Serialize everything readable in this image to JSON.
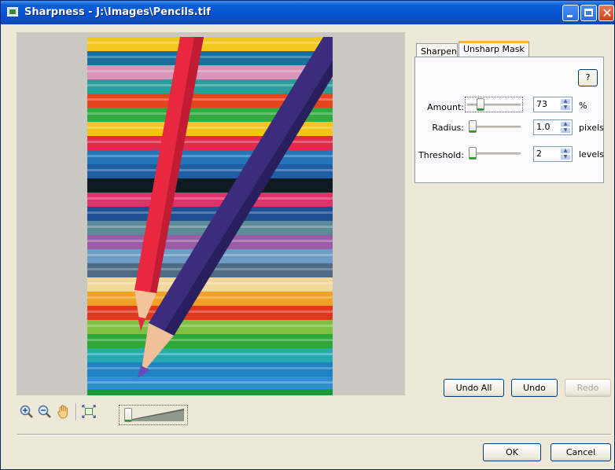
{
  "window": {
    "title": "Sharpness - J:\\Images\\Pencils.tif",
    "min_glyph": "_",
    "close_glyph": "✕"
  },
  "tabs": [
    {
      "label": "Sharpen",
      "selected": false
    },
    {
      "label": "Unsharp Mask",
      "selected": true
    }
  ],
  "unsharp": {
    "help_label": "?",
    "amount": {
      "label": "Amount:",
      "value": "73",
      "unit": "%",
      "level": 0.2
    },
    "radius": {
      "label": "Radius:",
      "value": "1.0",
      "unit": "pixels",
      "level": 0.0
    },
    "threshold": {
      "label": "Threshold:",
      "value": "2",
      "unit": "levels",
      "level": 0.0
    }
  },
  "history": {
    "undo_all": "Undo All",
    "undo": "Undo",
    "redo": "Redo"
  },
  "footer": {
    "ok": "OK",
    "cancel": "Cancel"
  },
  "toolbar": {
    "icons": [
      "zoom-in-icon",
      "zoom-out-icon",
      "hand-pan-icon",
      "fit-to-window-icon"
    ],
    "zoom_level": 0.0
  },
  "colors": {
    "title_bar": "#0652d0",
    "tab_highlight": "#f6b840",
    "slider_thumb_accent": "#21a121",
    "dialog_bg": "#ece9d8",
    "red_pencil": "#e8283f",
    "blue_pencil": "#3b2c7e"
  }
}
